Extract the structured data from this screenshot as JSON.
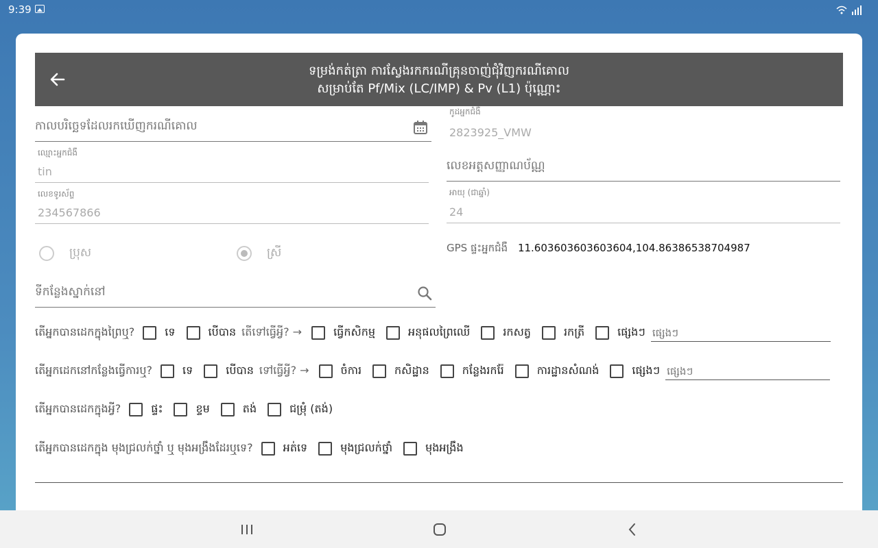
{
  "status_bar": {
    "time": "9:39"
  },
  "header": {
    "title_line1": "ទម្រង់កត់ត្រា ការស្វែងរកករណីគ្រុនចាញ់ជុំវិញករណីគោល",
    "title_line2": "សម្រាប់តែ Pf/Mix (LC/IMP) & Pv (L1) ប៉ុណ្ណោះ"
  },
  "form": {
    "date_found": {
      "placeholder": "កាលបរិច្ឆេទដែលរកឃើញករណីគោល"
    },
    "patient_code": {
      "label": "កូដអ្នកជំងឺ",
      "value": "2823925_VMW"
    },
    "patient_name": {
      "label": "ឈ្មោះអ្នកជំងឺ",
      "value": "tin"
    },
    "id_card": {
      "placeholder": "លេខអត្តសញ្ញាណប័ណ្ណ"
    },
    "phone": {
      "label": "លេខទូរស័ព្ទ",
      "value": "234567866"
    },
    "age": {
      "label": "អាយុ (ជាឆ្នាំ)",
      "value": "24"
    },
    "gender": {
      "male": "ប្រុស",
      "female": "ស្រី",
      "selected": "female"
    },
    "gps": {
      "label": "GPS ផ្ទះអ្នកជំងឺ",
      "value": "11.603603603603604,104.86386538704987"
    },
    "residence": {
      "placeholder": "ទីកន្លែងស្នាក់នៅ"
    }
  },
  "questions": {
    "q1": {
      "text": "តើអ្នកបានដេកក្នុងព្រៃឬ?",
      "opt_no": "ទេ",
      "opt_yes": "បើបាន",
      "sub": "តើទៅធ្វើអ្វី? →",
      "opts": [
        "ធ្វើកសិកម្ម",
        "អនុផលព្រៃឈើ",
        "រកសត្វ",
        "រកត្រី",
        "ផ្សេងៗ"
      ],
      "other_placeholder": "ផ្សេងៗ"
    },
    "q2": {
      "text": "តើអ្នកដេកនៅកន្លែងធ្វើការឬ?",
      "opt_no": "ទេ",
      "opt_yes": "បើបាន",
      "sub": "ទៅធ្វើអ្វី? →",
      "opts": [
        "ចំការ",
        "កសិដ្ឋាន",
        "កន្លែងរករ៉ែ",
        "ការដ្ឋានសំណង់",
        "ផ្សេងៗ"
      ],
      "other_placeholder": "ផ្សេងៗ"
    },
    "q3": {
      "text": "តើអ្នកបានដេកក្នុងអ្វី?",
      "opts": [
        "ផ្ទះ",
        "ខ្ទម",
        "តង់",
        "ជម្រុំ (តង់)"
      ]
    },
    "q4": {
      "text": "តើអ្នកបានដេកក្នុង មុងជ្រលក់ថ្នាំ ឬ មុងអង្រឹងដែរឬទេ?",
      "opts": [
        "អត់ទេ",
        "មុងជ្រលក់ថ្នាំ",
        "មុងអង្រឹង"
      ]
    }
  }
}
